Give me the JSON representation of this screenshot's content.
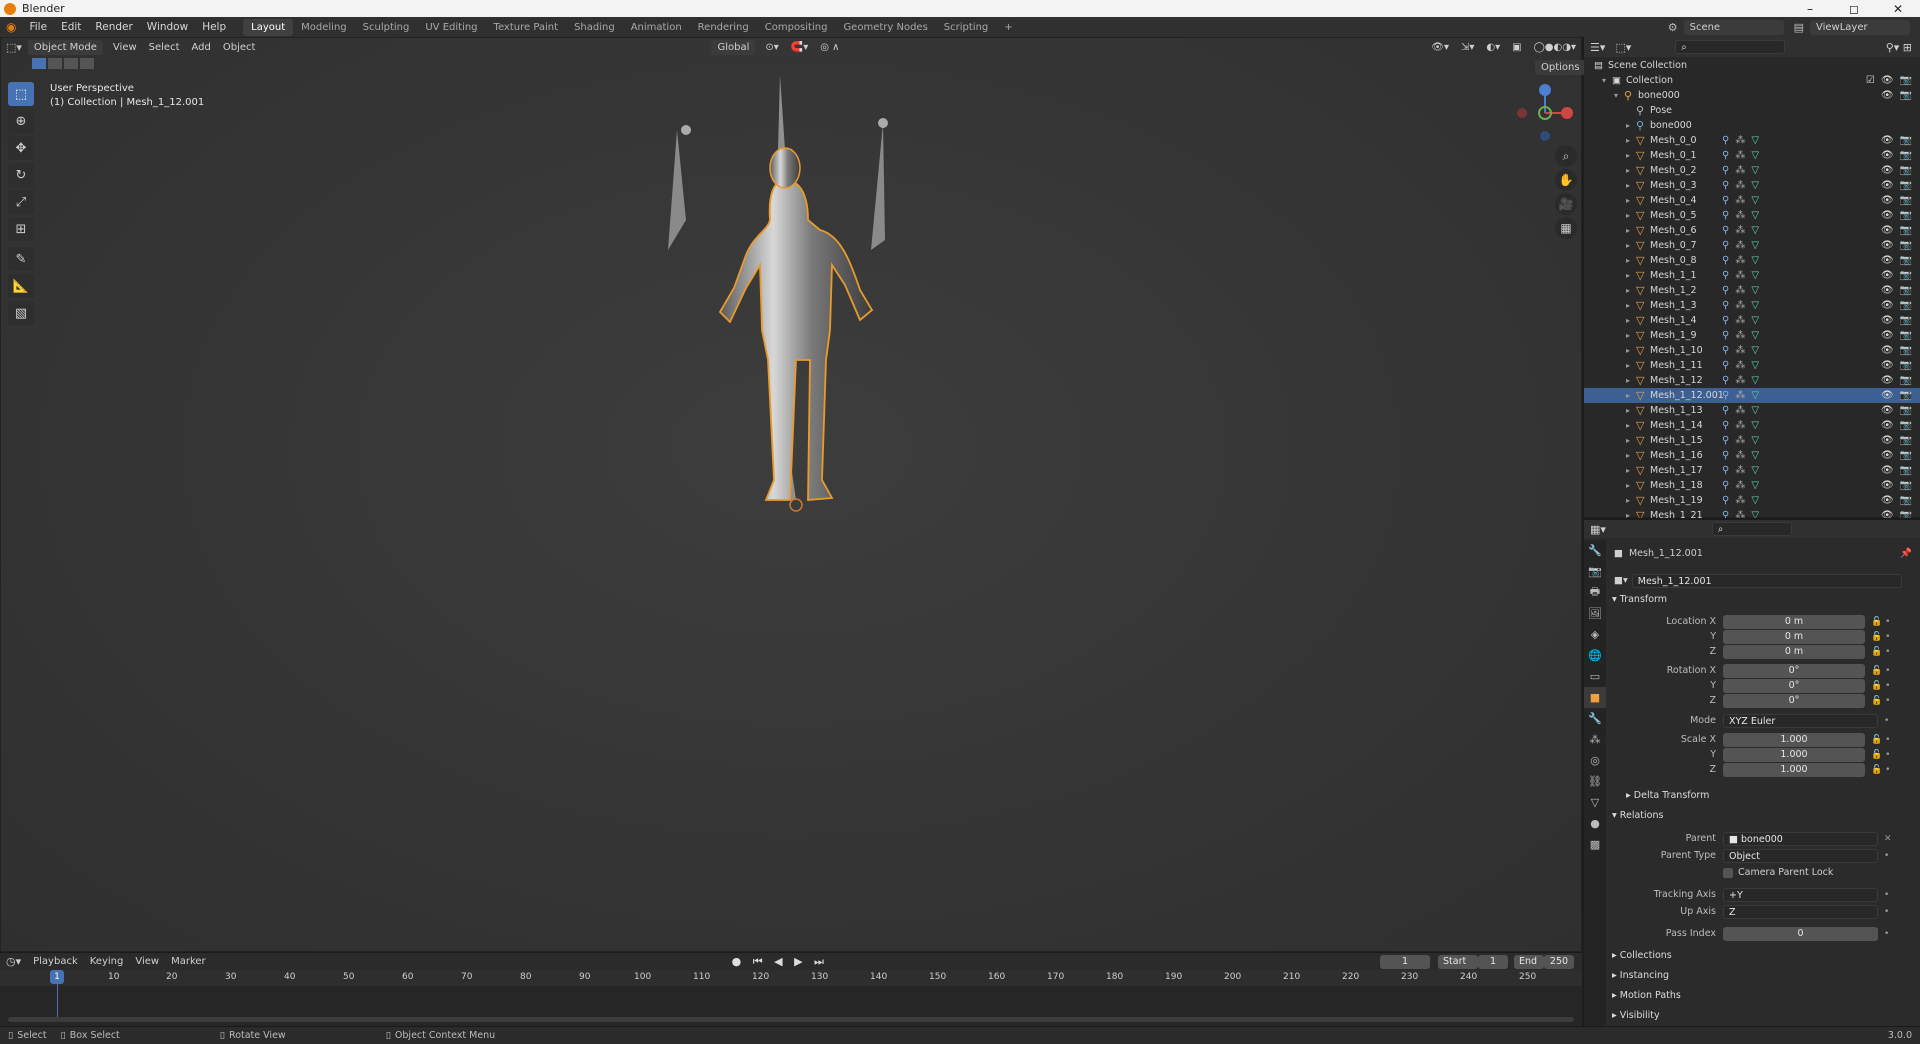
{
  "window": {
    "title": "Blender",
    "controls": [
      "–",
      "◻",
      "✕"
    ]
  },
  "menu": [
    "File",
    "Edit",
    "Render",
    "Window",
    "Help"
  ],
  "workspaces": [
    "Layout",
    "Modeling",
    "Sculpting",
    "UV Editing",
    "Texture Paint",
    "Shading",
    "Animation",
    "Rendering",
    "Compositing",
    "Geometry Nodes",
    "Scripting",
    "+"
  ],
  "active_workspace": "Layout",
  "scene": {
    "label": "Scene",
    "viewlayer": "ViewLayer"
  },
  "viewport": {
    "mode": "Object Mode",
    "menus": [
      "View",
      "Select",
      "Add",
      "Object"
    ],
    "orientation": "Global",
    "options": "Options",
    "perspective": "User Perspective",
    "context": "(1) Collection | Mesh_1_12.001"
  },
  "timeline": {
    "menus": [
      "Playback",
      "Keying",
      "View",
      "Marker"
    ],
    "current_frame": "1",
    "start_label": "Start",
    "start": "1",
    "end_label": "End",
    "end": "250",
    "ticks": [
      "1",
      "10",
      "20",
      "30",
      "40",
      "50",
      "60",
      "70",
      "80",
      "90",
      "100",
      "110",
      "120",
      "130",
      "140",
      "150",
      "160",
      "170",
      "180",
      "190",
      "200",
      "210",
      "220",
      "230",
      "240",
      "250"
    ]
  },
  "status": {
    "select": "Select",
    "box_select": "Box Select",
    "rotate": "Rotate View",
    "context_menu": "Object Context Menu",
    "version": "3.0.0"
  },
  "outliner": {
    "scene_collection": "Scene Collection",
    "collection": "Collection",
    "armature": "bone000",
    "pose": "Pose",
    "armature_data": "bone000",
    "meshes": [
      "Mesh_0_0",
      "Mesh_0_1",
      "Mesh_0_2",
      "Mesh_0_3",
      "Mesh_0_4",
      "Mesh_0_5",
      "Mesh_0_6",
      "Mesh_0_7",
      "Mesh_0_8",
      "Mesh_1_1",
      "Mesh_1_2",
      "Mesh_1_3",
      "Mesh_1_4",
      "Mesh_1_9",
      "Mesh_1_10",
      "Mesh_1_11",
      "Mesh_1_12",
      "Mesh_1_12.001",
      "Mesh_1_13",
      "Mesh_1_14",
      "Mesh_1_15",
      "Mesh_1_16",
      "Mesh_1_17",
      "Mesh_1_18",
      "Mesh_1_19",
      "Mesh_1_21"
    ],
    "selected": "Mesh_1_12.001"
  },
  "properties": {
    "object_name": "Mesh_1_12.001",
    "data_name": "Mesh_1_12.001",
    "transform": "Transform",
    "location_x_label": "Location X",
    "location_x": "0 m",
    "y_label": "Y",
    "location_y": "0 m",
    "z_label": "Z",
    "location_z": "0 m",
    "rotation_x_label": "Rotation X",
    "rotation_x": "0°",
    "rotation_y": "0°",
    "rotation_z": "0°",
    "mode_label": "Mode",
    "mode": "XYZ Euler",
    "scale_x_label": "Scale X",
    "scale_x": "1.000",
    "scale_y": "1.000",
    "scale_z": "1.000",
    "delta": "Delta Transform",
    "relations": "Relations",
    "parent_label": "Parent",
    "parent": "bone000",
    "parent_type_label": "Parent Type",
    "parent_type": "Object",
    "camera_lock": "Camera Parent Lock",
    "tracking_label": "Tracking Axis",
    "tracking": "+Y",
    "up_label": "Up Axis",
    "up": "Z",
    "pass_label": "Pass Index",
    "pass": "0",
    "collections": "Collections",
    "instancing": "Instancing",
    "motion_paths": "Motion Paths",
    "visibility": "Visibility"
  }
}
